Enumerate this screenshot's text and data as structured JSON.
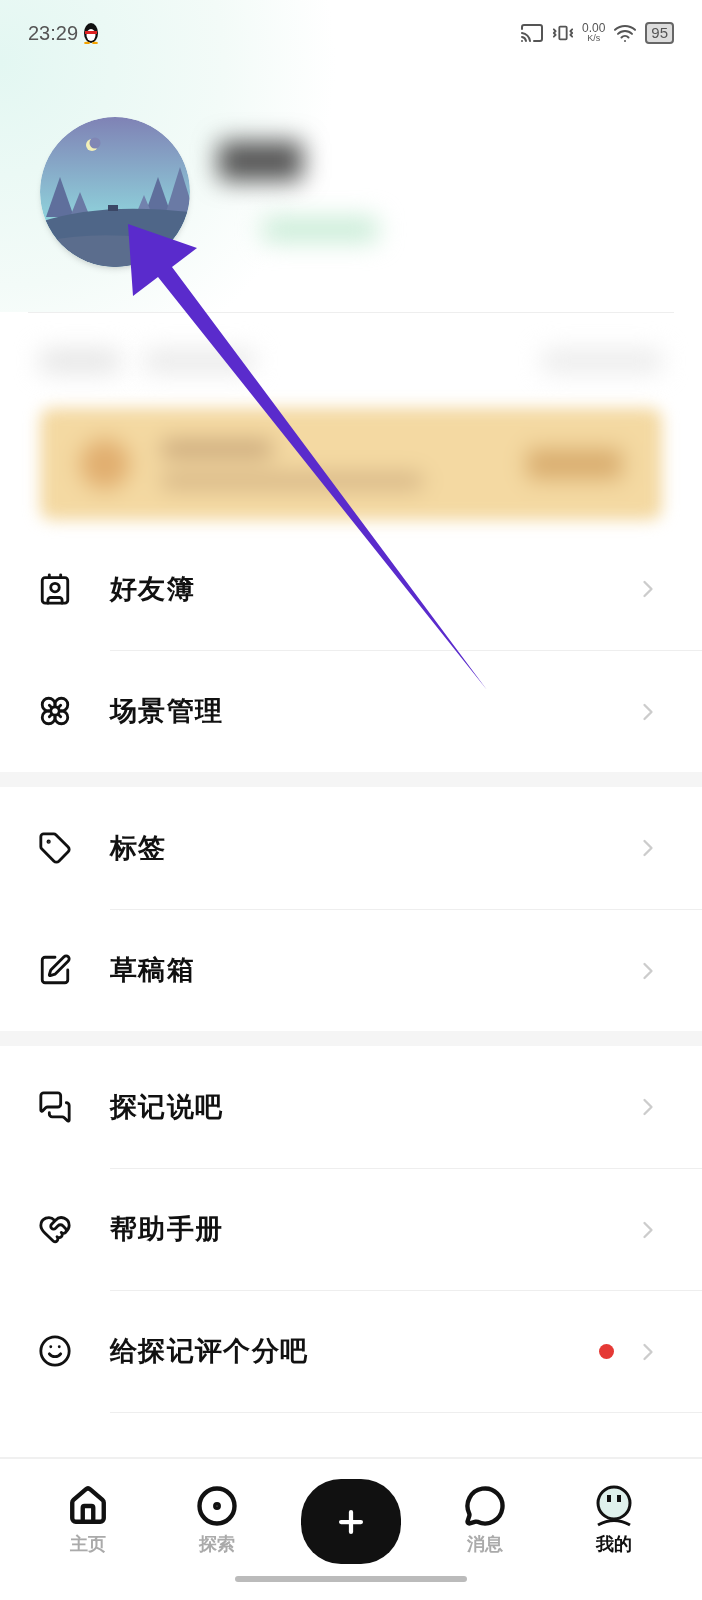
{
  "status_bar": {
    "time": "23:29",
    "net_speed": "0.00",
    "net_unit": "K/s",
    "battery": "95"
  },
  "menu_groups": [
    {
      "items": [
        {
          "kind": "contacts",
          "label": "好友簿",
          "dot": false
        },
        {
          "kind": "flower",
          "label": "场景管理",
          "dot": false
        }
      ]
    },
    {
      "items": [
        {
          "kind": "tag",
          "label": "标签",
          "dot": false
        },
        {
          "kind": "edit",
          "label": "草稿箱",
          "dot": false
        }
      ]
    },
    {
      "items": [
        {
          "kind": "chat",
          "label": "探记说吧",
          "dot": false
        },
        {
          "kind": "heart",
          "label": "帮助手册",
          "dot": false
        },
        {
          "kind": "smile",
          "label": "给探记评个分吧",
          "dot": true
        }
      ]
    }
  ],
  "bottom_nav": [
    {
      "kind": "home",
      "label": "主页",
      "selected": false
    },
    {
      "kind": "explore",
      "label": "探索",
      "selected": false
    },
    {
      "kind": "add"
    },
    {
      "kind": "message",
      "label": "消息",
      "selected": false
    },
    {
      "kind": "me",
      "label": "我的",
      "selected": true
    }
  ]
}
